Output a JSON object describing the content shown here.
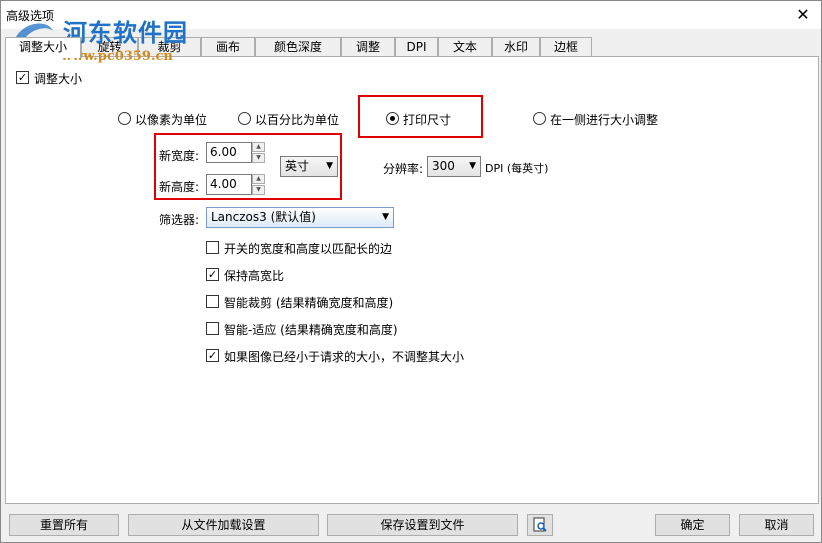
{
  "window": {
    "title": "高级选项",
    "close_glyph": "✕"
  },
  "watermark": {
    "site_name": "河东软件园",
    "url": "www.pc0359.cn"
  },
  "tabs": [
    {
      "label": "调整大小",
      "active": true
    },
    {
      "label": "旋转"
    },
    {
      "label": "裁剪"
    },
    {
      "label": "画布"
    },
    {
      "label": "颜色深度"
    },
    {
      "label": "调整"
    },
    {
      "label": "DPI"
    },
    {
      "label": "文本"
    },
    {
      "label": "水印"
    },
    {
      "label": "边框"
    }
  ],
  "resize": {
    "enable_label": "调整大小",
    "enable_checked": true,
    "modes": [
      {
        "label": "以像素为单位",
        "checked": false
      },
      {
        "label": "以百分比为单位",
        "checked": false
      },
      {
        "label": "打印尺寸",
        "checked": true
      },
      {
        "label": "在一侧进行大小调整",
        "checked": false
      }
    ],
    "width_label": "新宽度:",
    "width_value": "6.00",
    "height_label": "新高度:",
    "height_value": "4.00",
    "unit_value": "英寸",
    "resolution_label": "分辨率:",
    "resolution_value": "300",
    "resolution_unit": "DPI (每英寸)",
    "filter_label": "筛选器:",
    "filter_value": "Lanczos3 (默认值)",
    "options": [
      {
        "label": "开关的宽度和高度以匹配长的边",
        "checked": false
      },
      {
        "label": "保持高宽比",
        "checked": true
      },
      {
        "label": "智能裁剪 (结果精确宽度和高度)",
        "checked": false
      },
      {
        "label": "智能-适应 (结果精确宽度和高度)",
        "checked": false
      },
      {
        "label": "如果图像已经小于请求的大小，不调整其大小",
        "checked": true
      }
    ]
  },
  "buttons": {
    "reset": "重置所有",
    "load": "从文件加载设置",
    "save": "保存设置到文件",
    "preview_icon": "preview-magnifier-icon",
    "ok": "确定",
    "cancel": "取消"
  },
  "colors": {
    "highlight_border": "#e00000",
    "watermark_blue": "#1f72c6",
    "watermark_orange": "#d08a20"
  }
}
